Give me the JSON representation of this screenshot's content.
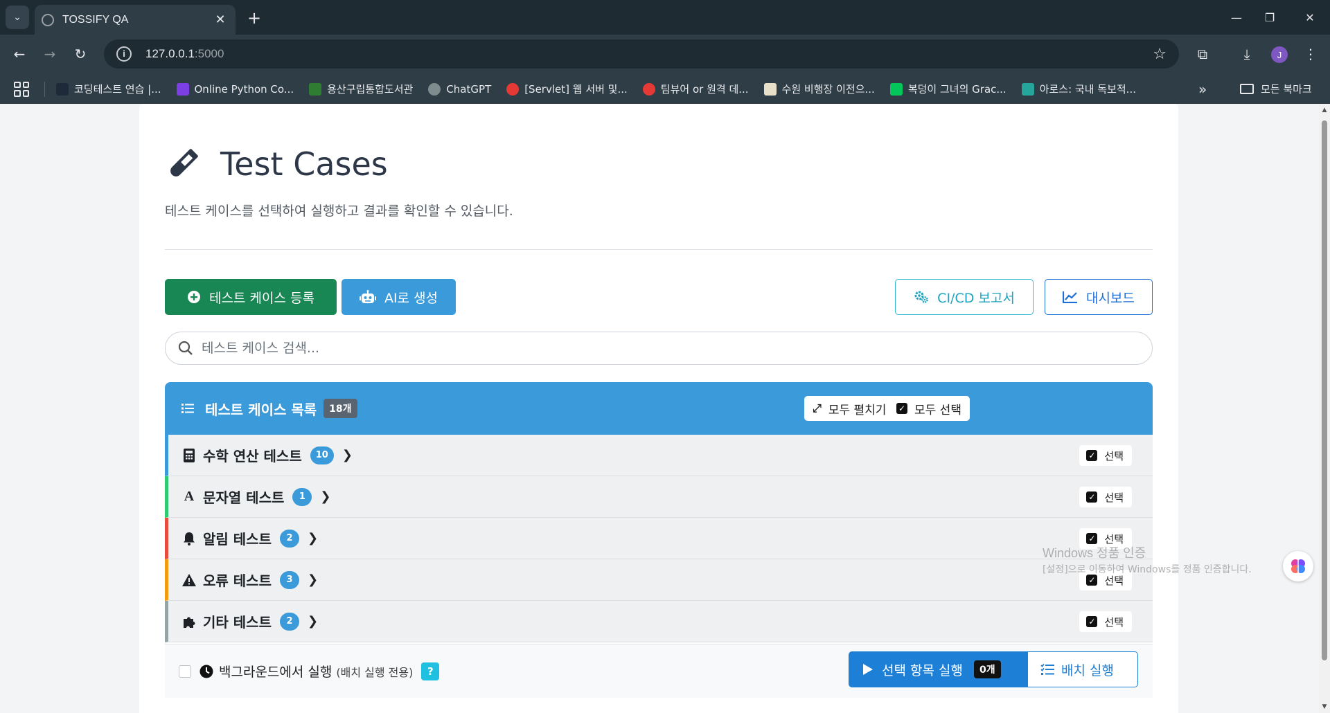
{
  "browser": {
    "tab_title": "TOSSIFY QA",
    "url_host": "127.0.0.1",
    "url_port": ":5000",
    "profile_initial": "J",
    "bookmarks": [
      {
        "label": "코딩테스트 연습 |...",
        "color": "#1e2a3a"
      },
      {
        "label": "Online Python Co...",
        "color": "#7b3fe4"
      },
      {
        "label": "용산구립통합도서관",
        "color": "#2e7d32"
      },
      {
        "label": "ChatGPT",
        "color": "#7f8c8d"
      },
      {
        "label": "[Servlet] 웹 서버 및...",
        "color": "#e53935"
      },
      {
        "label": "팀뷰어 or 원격 데...",
        "color": "#e53935"
      },
      {
        "label": "수원 비행장 이전으...",
        "color": "#e8e0c8"
      },
      {
        "label": "복덩이 그녀의 Grac...",
        "color": "#03c75a"
      },
      {
        "label": "아로스: 국내 독보적...",
        "color": "#26a69a"
      }
    ],
    "all_bookmarks_label": "모든 북마크"
  },
  "page": {
    "title": "Test Cases",
    "subtitle": "테스트 케이스를 선택하여 실행하고 결과를 확인할 수 있습니다.",
    "buttons": {
      "register": "테스트 케이스 등록",
      "ai_generate": "AI로 생성",
      "cicd_report": "CI/CD 보고서",
      "dashboard": "대시보드"
    },
    "search_placeholder": "테스트 케이스 검색...",
    "list": {
      "title": "테스트 케이스 목록",
      "count": "18개",
      "expand_all": "모두 펼치기",
      "select_all": "모두 선택"
    },
    "categories": [
      {
        "name": "수학 연산 테스트",
        "count": "10",
        "icon": "calculator-icon",
        "accent": "#3b9ad9",
        "select_label": "선택"
      },
      {
        "name": "문자열 테스트",
        "count": "1",
        "icon": "font-icon",
        "accent": "#2ecc71",
        "select_label": "선택"
      },
      {
        "name": "알림 테스트",
        "count": "2",
        "icon": "bell-icon",
        "accent": "#e74c3c",
        "select_label": "선택"
      },
      {
        "name": "오류 테스트",
        "count": "3",
        "icon": "warning-icon",
        "accent": "#f39c12",
        "select_label": "선택"
      },
      {
        "name": "기타 테스트",
        "count": "2",
        "icon": "puzzle-icon",
        "accent": "#95a5a6",
        "select_label": "선택"
      }
    ],
    "bottom": {
      "background_label": "백그라운드에서 실행",
      "background_hint": "(배치 실행 전용)",
      "help": "?",
      "run_selected": "선택 항목 실행",
      "run_count": "0개",
      "batch_run": "배치 실행"
    }
  },
  "overlay": {
    "watermark_title": "Windows 정품 인증",
    "watermark_sub": "[설정]으로 이동하여 Windows를 정품 인증합니다."
  }
}
